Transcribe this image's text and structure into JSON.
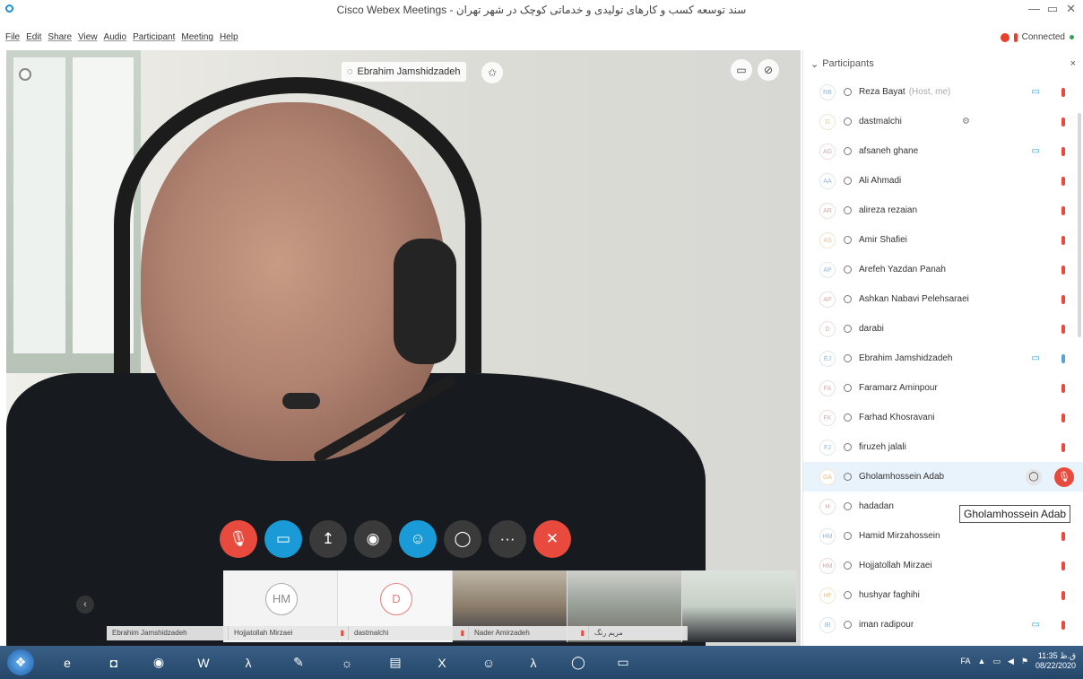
{
  "window": {
    "title": "Cisco Webex Meetings - سند توسعه کسب و کارهای تولیدی و خدماتی کوچک در شهر تهران",
    "minimize": "—",
    "maximize": "▭",
    "close": "✕"
  },
  "menu": [
    "File",
    "Edit",
    "Share",
    "View",
    "Audio",
    "Participant",
    "Meeting",
    "Help"
  ],
  "status": {
    "label": "Connected"
  },
  "video": {
    "active_speaker": "Ebrahim Jamshidzadeh"
  },
  "thumbnails": [
    {
      "initials": "HM"
    },
    {
      "initials": "D"
    }
  ],
  "thumbnail_names": [
    "Ebrahim Jamshidzadeh",
    "Hojjatollah Mirzaei",
    "dastmalchi",
    "Nader Amirzadeh",
    "مریم رنگ"
  ],
  "panel": {
    "title": "Participants",
    "close": "×",
    "participants": [
      {
        "initials": "RB",
        "name": "Reza Bayat",
        "note": "(Host, me)",
        "cam": true,
        "mic": "red"
      },
      {
        "initials": "D",
        "name": "dastmalchi",
        "note": "",
        "cam": false,
        "mic": "red"
      },
      {
        "initials": "AG",
        "name": "afsaneh ghane",
        "note": "",
        "cam": true,
        "mic": "red"
      },
      {
        "initials": "AA",
        "name": "Ali Ahmadi",
        "note": "",
        "cam": false,
        "mic": "red"
      },
      {
        "initials": "AR",
        "name": "alireza rezaian",
        "note": "",
        "cam": false,
        "mic": "red"
      },
      {
        "initials": "AS",
        "name": "Amir Shafiei",
        "note": "",
        "cam": false,
        "mic": "red"
      },
      {
        "initials": "AP",
        "name": "Arefeh Yazdan Panah",
        "note": "",
        "cam": false,
        "mic": "red"
      },
      {
        "initials": "AP",
        "name": "Ashkan Nabavi Pelehsaraei",
        "note": "",
        "cam": false,
        "mic": "red"
      },
      {
        "initials": "D",
        "name": "darabi",
        "note": "",
        "cam": false,
        "mic": "red"
      },
      {
        "initials": "EJ",
        "name": "Ebrahim Jamshidzadeh",
        "note": "",
        "cam": true,
        "mic": "blue"
      },
      {
        "initials": "FA",
        "name": "Faramarz Aminpour",
        "note": "",
        "cam": false,
        "mic": "red"
      },
      {
        "initials": "FK",
        "name": "Farhad Khosravani",
        "note": "",
        "cam": false,
        "mic": "red"
      },
      {
        "initials": "FJ",
        "name": "firuzeh jalali",
        "note": "",
        "cam": false,
        "mic": "red"
      },
      {
        "initials": "GA",
        "name": "Gholamhossein Adab",
        "note": "",
        "cam": false,
        "mic": "red-big"
      },
      {
        "initials": "H",
        "name": "hadadan",
        "note": "",
        "cam": false,
        "mic": "none"
      },
      {
        "initials": "HM",
        "name": "Hamid Mirzahossein",
        "note": "",
        "cam": false,
        "mic": "red"
      },
      {
        "initials": "HM",
        "name": "Hojjatollah Mirzaei",
        "note": "",
        "cam": false,
        "mic": "red"
      },
      {
        "initials": "HF",
        "name": "hushyar faghihi",
        "note": "",
        "cam": false,
        "mic": "red"
      },
      {
        "initials": "IR",
        "name": "iman radipour",
        "note": "",
        "cam": true,
        "mic": "red"
      }
    ],
    "tooltip": "Gholamhossein Adab"
  },
  "taskbar": {
    "lang": "FA",
    "time": "11:35 ق.ظ",
    "date": "08/22/2020"
  },
  "colors": {
    "accent_blue": "#1a9bd7",
    "mute_red": "#e84b3d",
    "taskbar": "#2c507a"
  }
}
